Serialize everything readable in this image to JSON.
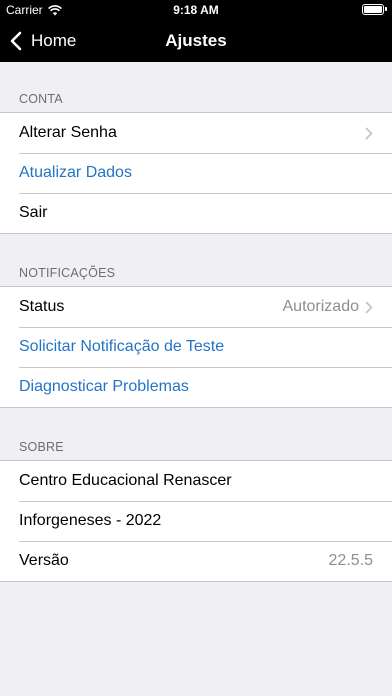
{
  "status_bar": {
    "carrier": "Carrier",
    "time": "9:18 AM",
    "battery_level": 1.0
  },
  "nav": {
    "back_label": "Home",
    "title": "Ajustes"
  },
  "sections": {
    "conta": {
      "header": "CONTA",
      "rows": [
        {
          "label": "Alterar Senha"
        },
        {
          "label": "Atualizar Dados"
        },
        {
          "label": "Sair"
        }
      ]
    },
    "notificacoes": {
      "header": "NOTIFICAÇÕES",
      "rows": [
        {
          "label": "Status",
          "detail": "Autorizado"
        },
        {
          "label": "Solicitar Notificação de Teste"
        },
        {
          "label": "Diagnosticar Problemas"
        }
      ]
    },
    "sobre": {
      "header": "SOBRE",
      "rows": [
        {
          "label": "Centro Educacional Renascer"
        },
        {
          "label": "Inforgeneses - 2022"
        },
        {
          "label": "Versão",
          "detail": "22.5.5"
        }
      ]
    }
  },
  "colors": {
    "link": "#2374c6",
    "background": "#efeff4",
    "bar": "#000000"
  },
  "icons": {
    "status": [
      "wifi-icon",
      "battery-icon"
    ],
    "nav_back": "chevron-left-icon",
    "disclosure": "chevron-right-icon"
  }
}
